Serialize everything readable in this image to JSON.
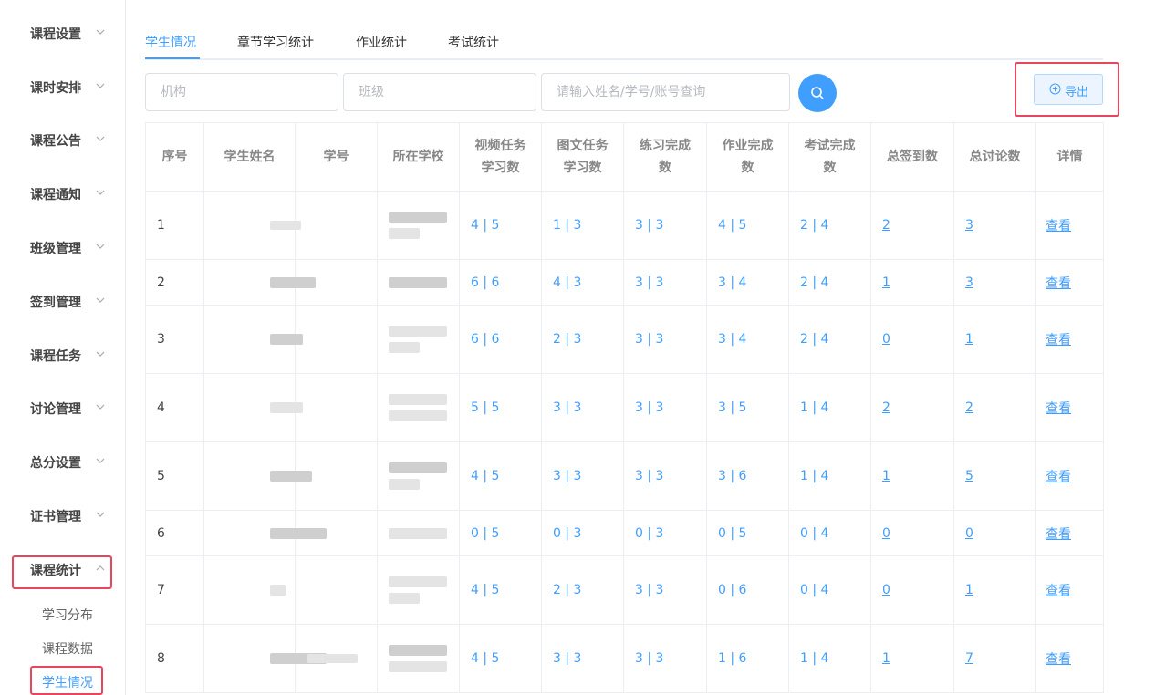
{
  "sidebar": {
    "items": [
      {
        "label": "课程设置"
      },
      {
        "label": "课时安排"
      },
      {
        "label": "课程公告"
      },
      {
        "label": "课程通知"
      },
      {
        "label": "班级管理"
      },
      {
        "label": "签到管理"
      },
      {
        "label": "课程任务"
      },
      {
        "label": "讨论管理"
      },
      {
        "label": "总分设置"
      },
      {
        "label": "证书管理"
      },
      {
        "label": "课程统计"
      }
    ],
    "sub_items": [
      {
        "label": "学习分布"
      },
      {
        "label": "课程数据"
      },
      {
        "label": "学生情况"
      }
    ]
  },
  "tabs": [
    {
      "label": "学生情况"
    },
    {
      "label": "章节学习统计"
    },
    {
      "label": "作业统计"
    },
    {
      "label": "考试统计"
    }
  ],
  "filters": {
    "org_placeholder": "机构",
    "class_placeholder": "班级",
    "search_placeholder": "请输入姓名/学号/账号查询"
  },
  "export_label": "导出",
  "table": {
    "headers": [
      {
        "l1": "序号",
        "l2": ""
      },
      {
        "l1": "学生姓名",
        "l2": ""
      },
      {
        "l1": "学号",
        "l2": ""
      },
      {
        "l1": "所在学校",
        "l2": ""
      },
      {
        "l1": "视频任务",
        "l2": "学习数"
      },
      {
        "l1": "图文任务",
        "l2": "学习数"
      },
      {
        "l1": "练习完成",
        "l2": "数"
      },
      {
        "l1": "作业完成",
        "l2": "数"
      },
      {
        "l1": "考试完成",
        "l2": "数"
      },
      {
        "l1": "总签到数",
        "l2": ""
      },
      {
        "l1": "总讨论数",
        "l2": ""
      },
      {
        "l1": "详情",
        "l2": ""
      }
    ],
    "rows": [
      {
        "no": "1",
        "video": "4 | 5",
        "text": "1 | 3",
        "practice": "3 | 3",
        "homework": "4 | 5",
        "exam": "2 | 4",
        "checkin": "2",
        "discuss": "3",
        "view": "查看"
      },
      {
        "no": "2",
        "video": "6 | 6",
        "text": "4 | 3",
        "practice": "3 | 3",
        "homework": "3 | 4",
        "exam": "2 | 4",
        "checkin": "1",
        "discuss": "3",
        "view": "查看"
      },
      {
        "no": "3",
        "video": "6 | 6",
        "text": "2 | 3",
        "practice": "3 | 3",
        "homework": "3 | 4",
        "exam": "2 | 4",
        "checkin": "0",
        "discuss": "1",
        "view": "查看"
      },
      {
        "no": "4",
        "video": "5 | 5",
        "text": "3 | 3",
        "practice": "3 | 3",
        "homework": "3 | 5",
        "exam": "1 | 4",
        "checkin": "2",
        "discuss": "2",
        "view": "查看"
      },
      {
        "no": "5",
        "video": "4 | 5",
        "text": "3 | 3",
        "practice": "3 | 3",
        "homework": "3 | 6",
        "exam": "1 | 4",
        "checkin": "1",
        "discuss": "5",
        "view": "查看"
      },
      {
        "no": "6",
        "video": "0 | 5",
        "text": "0 | 3",
        "practice": "0 | 3",
        "homework": "0 | 5",
        "exam": "0 | 4",
        "checkin": "0",
        "discuss": "0",
        "view": "查看"
      },
      {
        "no": "7",
        "video": "4 | 5",
        "text": "2 | 3",
        "practice": "3 | 3",
        "homework": "0 | 6",
        "exam": "0 | 4",
        "checkin": "0",
        "discuss": "1",
        "view": "查看"
      },
      {
        "no": "8",
        "video": "4 | 5",
        "text": "3 | 3",
        "practice": "3 | 3",
        "homework": "1 | 6",
        "exam": "1 | 4",
        "checkin": "1",
        "discuss": "7",
        "view": "查看"
      }
    ]
  },
  "colors": {
    "accent": "#409eff",
    "highlight": "#e8465e",
    "border": "#ebeef5"
  }
}
